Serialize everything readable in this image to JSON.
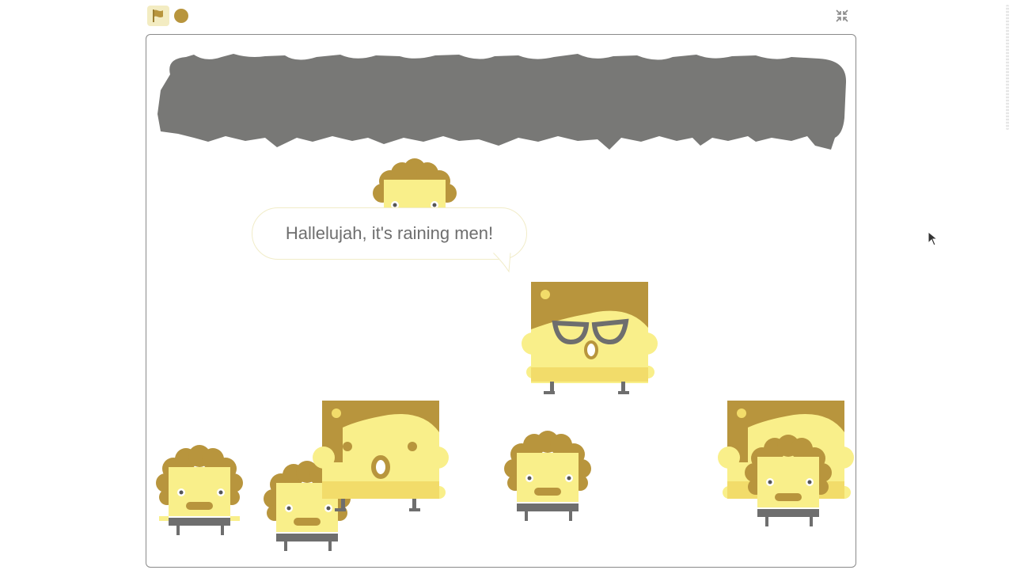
{
  "toolbar": {
    "green_flag_icon": "flag-icon",
    "stop_icon": "stop-icon",
    "fullscreen_icon": "collapse-fullscreen-icon"
  },
  "stage": {
    "speech_bubble": {
      "text": "Hallelujah, it's raining men!"
    },
    "sprites": [
      {
        "name": "curly-man"
      },
      {
        "name": "sunglasses-woman"
      },
      {
        "name": "curly-man"
      },
      {
        "name": "curly-man"
      },
      {
        "name": "square-woman"
      },
      {
        "name": "curly-man"
      },
      {
        "name": "square-woman"
      },
      {
        "name": "curly-man"
      }
    ]
  },
  "colors": {
    "skin": "#f9ef8a",
    "hair": "#b8953d",
    "title_shadow": "#787876",
    "stroke_gray": "#6e6e6e"
  }
}
